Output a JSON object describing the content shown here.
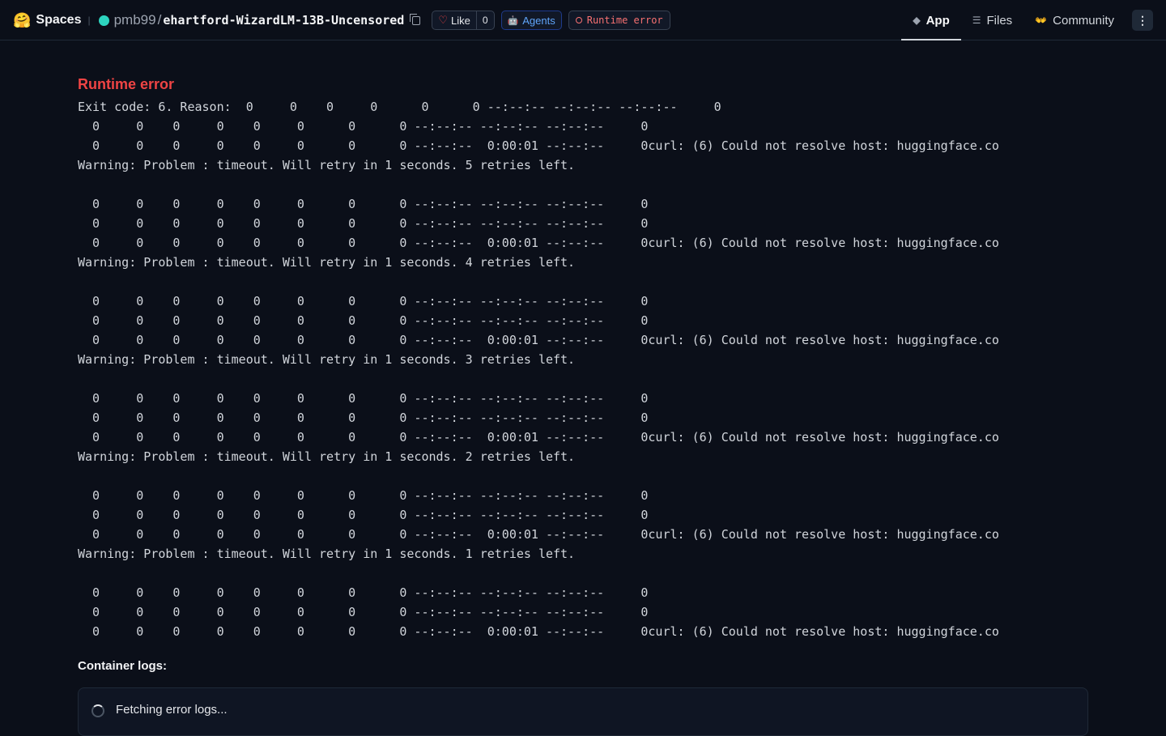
{
  "header": {
    "logo_icon": "hugging-face-emoji",
    "spaces_label": "Spaces",
    "separator": "|",
    "owner": "pmb99",
    "slash": "/",
    "repo_name": "ehartford-WizardLM-13B-Uncensored",
    "like_label": "Like",
    "like_count": "0",
    "agents_label": "Agents",
    "status_label": "Runtime error",
    "tabs": [
      {
        "label": "App",
        "icon": "cube-icon",
        "active": true
      },
      {
        "label": "Files",
        "icon": "files-icon",
        "active": false
      },
      {
        "label": "Community",
        "icon": "community-icon",
        "active": false
      }
    ],
    "menu_icon": "kebab-menu-icon"
  },
  "main": {
    "error_title": "Runtime error",
    "log_text": "Exit code: 6. Reason:  0     0    0     0      0      0 --:--:-- --:--:-- --:--:--     0\n  0     0    0     0    0     0      0      0 --:--:-- --:--:-- --:--:--     0\n  0     0    0     0    0     0      0      0 --:--:--  0:00:01 --:--:--     0curl: (6) Could not resolve host: huggingface.co\nWarning: Problem : timeout. Will retry in 1 seconds. 5 retries left.\n\n  0     0    0     0    0     0      0      0 --:--:-- --:--:-- --:--:--     0\n  0     0    0     0    0     0      0      0 --:--:-- --:--:-- --:--:--     0\n  0     0    0     0    0     0      0      0 --:--:--  0:00:01 --:--:--     0curl: (6) Could not resolve host: huggingface.co\nWarning: Problem : timeout. Will retry in 1 seconds. 4 retries left.\n\n  0     0    0     0    0     0      0      0 --:--:-- --:--:-- --:--:--     0\n  0     0    0     0    0     0      0      0 --:--:-- --:--:-- --:--:--     0\n  0     0    0     0    0     0      0      0 --:--:--  0:00:01 --:--:--     0curl: (6) Could not resolve host: huggingface.co\nWarning: Problem : timeout. Will retry in 1 seconds. 3 retries left.\n\n  0     0    0     0    0     0      0      0 --:--:-- --:--:-- --:--:--     0\n  0     0    0     0    0     0      0      0 --:--:-- --:--:-- --:--:--     0\n  0     0    0     0    0     0      0      0 --:--:--  0:00:01 --:--:--     0curl: (6) Could not resolve host: huggingface.co\nWarning: Problem : timeout. Will retry in 1 seconds. 2 retries left.\n\n  0     0    0     0    0     0      0      0 --:--:-- --:--:-- --:--:--     0\n  0     0    0     0    0     0      0      0 --:--:-- --:--:-- --:--:--     0\n  0     0    0     0    0     0      0      0 --:--:--  0:00:01 --:--:--     0curl: (6) Could not resolve host: huggingface.co\nWarning: Problem : timeout. Will retry in 1 seconds. 1 retries left.\n\n  0     0    0     0    0     0      0      0 --:--:-- --:--:-- --:--:--     0\n  0     0    0     0    0     0      0      0 --:--:-- --:--:-- --:--:--     0\n  0     0    0     0    0     0      0      0 --:--:--  0:00:01 --:--:--     0curl: (6) Could not resolve host: huggingface.co",
    "container_logs_label": "Container logs:",
    "fetching_label": "Fetching error logs..."
  },
  "colors": {
    "background": "#0b0f19",
    "error_red": "#ef4444",
    "agents_blue": "#60a5fa",
    "status_dot": "#2dd4bf"
  }
}
